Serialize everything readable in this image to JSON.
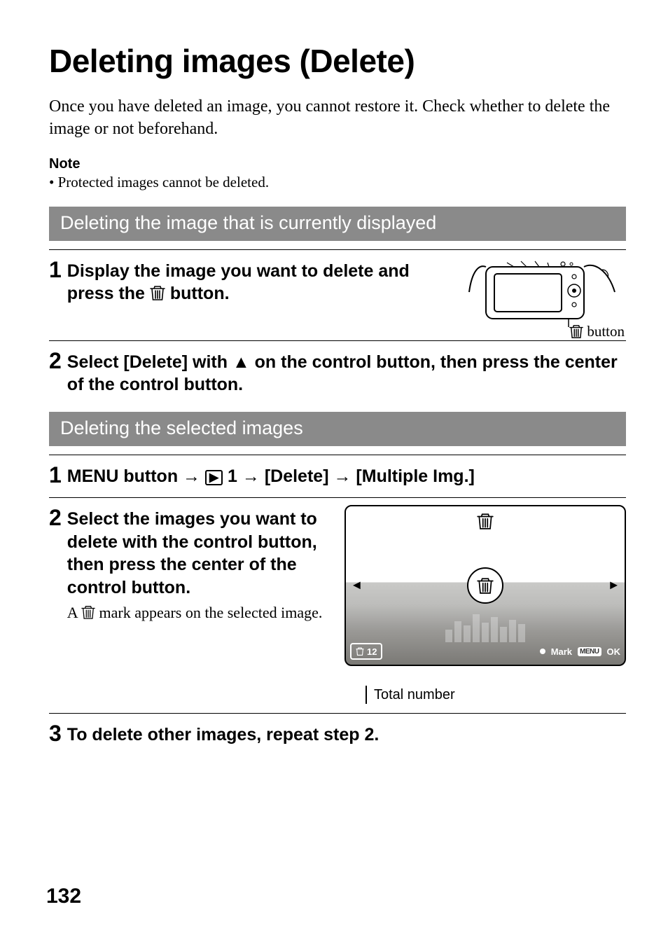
{
  "title": "Deleting images (Delete)",
  "intro": "Once you have deleted an image, you cannot restore it. Check whether to delete the image or not beforehand.",
  "note_head": "Note",
  "note_body": "• Protected images cannot be deleted.",
  "section1": "Deleting the image that is currently displayed",
  "section2": "Deleting the selected images",
  "steps_a": {
    "s1_pre": "Display the image you want to delete and press the ",
    "s1_post": " button.",
    "cam_caption": "button",
    "s2_pre": "Select [Delete] with ",
    "s2_post": " on the control button, then press the center of the control button."
  },
  "steps_b": {
    "s1_pre": "MENU button ",
    "s1_mid1": " 1 ",
    "s1_mid2": " [Delete] ",
    "s1_post": " [Multiple Img.]",
    "s2_head": "Select the images you want to delete with the control button, then press the center of the control button.",
    "s2_sub_pre": "A ",
    "s2_sub_post": " mark appears on the selected image.",
    "total_caption": "Total number",
    "footer_count": "12",
    "footer_mark": "Mark",
    "footer_menu": "MENU",
    "footer_ok": "OK",
    "s3": "To delete other images, repeat step 2."
  },
  "nums": {
    "a1": "1",
    "a2": "2",
    "b1": "1",
    "b2": "2",
    "b3": "3"
  },
  "page": "132"
}
